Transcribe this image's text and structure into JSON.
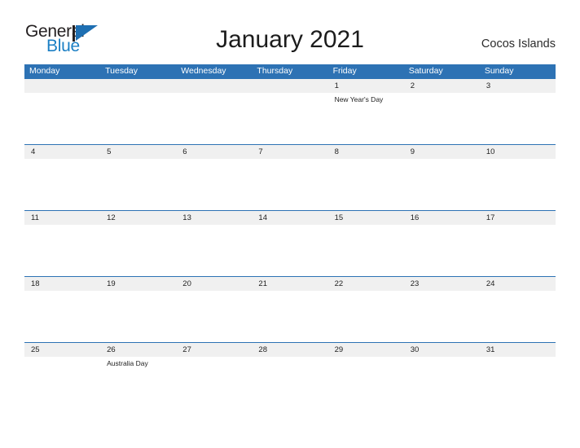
{
  "brand": {
    "word_one": "General",
    "word_two": "Blue",
    "mark": "triangle-logo-icon",
    "color_dark": "#231f20",
    "color_blue": "#1b7fc4"
  },
  "header": {
    "title": "January 2021",
    "region": "Cocos Islands"
  },
  "theme": {
    "header_blue": "#2d72b4",
    "row_gray": "#f0f0f0",
    "rule_blue": "#2d72b4"
  },
  "calendar": {
    "weekdays": [
      "Monday",
      "Tuesday",
      "Wednesday",
      "Thursday",
      "Friday",
      "Saturday",
      "Sunday"
    ],
    "weeks": [
      {
        "dates": [
          "",
          "",
          "",
          "",
          "1",
          "2",
          "3"
        ],
        "events": [
          "",
          "",
          "",
          "",
          "New Year's Day",
          "",
          ""
        ]
      },
      {
        "dates": [
          "4",
          "5",
          "6",
          "7",
          "8",
          "9",
          "10"
        ],
        "events": [
          "",
          "",
          "",
          "",
          "",
          "",
          ""
        ]
      },
      {
        "dates": [
          "11",
          "12",
          "13",
          "14",
          "15",
          "16",
          "17"
        ],
        "events": [
          "",
          "",
          "",
          "",
          "",
          "",
          ""
        ]
      },
      {
        "dates": [
          "18",
          "19",
          "20",
          "21",
          "22",
          "23",
          "24"
        ],
        "events": [
          "",
          "",
          "",
          "",
          "",
          "",
          ""
        ]
      },
      {
        "dates": [
          "25",
          "26",
          "27",
          "28",
          "29",
          "30",
          "31"
        ],
        "events": [
          "",
          "Australia Day",
          "",
          "",
          "",
          "",
          ""
        ]
      }
    ]
  }
}
